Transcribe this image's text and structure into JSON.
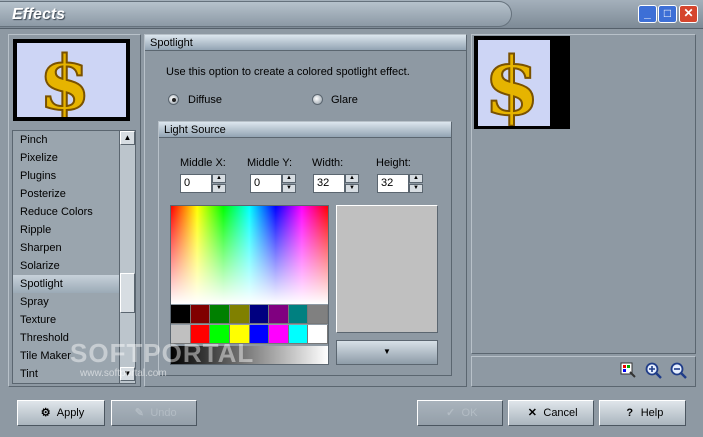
{
  "window": {
    "title": "Effects",
    "buttons": {
      "minimize": "_",
      "maximize": "□",
      "close": "✕"
    }
  },
  "effects_list": {
    "items": [
      "Pinch",
      "Pixelize",
      "Plugins",
      "Posterize",
      "Reduce Colors",
      "Ripple",
      "Sharpen",
      "Solarize",
      "Spotlight",
      "Spray",
      "Texture",
      "Threshold",
      "Tile Maker",
      "Tint"
    ],
    "selected": "Spotlight"
  },
  "spotlight": {
    "header": "Spotlight",
    "description": "Use this option to create a colored spotlight effect.",
    "diffuse_label": "Diffuse",
    "glare_label": "Glare",
    "selected_mode": "Diffuse"
  },
  "light_source": {
    "header": "Light Source",
    "middle_x_label": "Middle X:",
    "middle_x_value": "0",
    "middle_y_label": "Middle Y:",
    "middle_y_value": "0",
    "width_label": "Width:",
    "width_value": "32",
    "height_label": "Height:",
    "height_value": "32",
    "swatches_row1": [
      "#000000",
      "#800000",
      "#008000",
      "#808000",
      "#000080",
      "#800080",
      "#008080",
      "#808080"
    ],
    "swatches_row2": [
      "#c0c0c0",
      "#ff0000",
      "#00ff00",
      "#ffff00",
      "#0000ff",
      "#ff00ff",
      "#00ffff",
      "#ffffff"
    ],
    "preview_color": "#c0c0c0"
  },
  "buttons": {
    "apply": "Apply",
    "undo": "Undo",
    "ok": "OK",
    "cancel": "Cancel",
    "help": "Help"
  },
  "watermark": {
    "main": "SOFTPORTAL",
    "sub": "www.softportal.com"
  },
  "icons": [
    "dollar-sign-thumbnail",
    "color-picker-icon",
    "zoom-in-icon",
    "zoom-out-icon",
    "apply-icon",
    "undo-icon",
    "ok-icon",
    "cancel-icon",
    "help-icon"
  ]
}
